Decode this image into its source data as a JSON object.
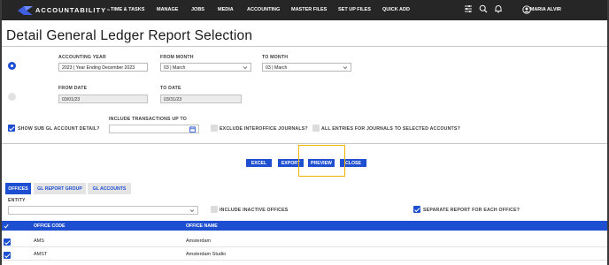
{
  "brand": {
    "name": "ACCOUNTABILITY",
    "tm": "™"
  },
  "nav": {
    "items": [
      "TIME & TASKS",
      "MANAGE",
      "JOBS",
      "MEDIA",
      "ACCOUNTING",
      "MASTER FILES",
      "SET UP FILES",
      "QUICK ADD"
    ],
    "user": "MARIA ALVIR"
  },
  "page": {
    "title": "Detail General Ledger Report Selection"
  },
  "form": {
    "accounting_year_label": "ACCOUNTING YEAR",
    "accounting_year_value": "2023 | Year Ending December 2023",
    "from_month_label": "FROM MONTH",
    "from_month_value": "03 | March",
    "to_month_label": "TO MONTH",
    "to_month_value": "03 | March",
    "from_date_label": "FROM DATE",
    "from_date_value": "03/01/23",
    "to_date_label": "TO DATE",
    "to_date_value": "03/31/23",
    "show_sub_label": "SHOW SUB GL ACCOUNT DETAIL?",
    "include_up_to_label": "INCLUDE TRANSACTIONS UP TO",
    "include_up_to_value": "",
    "exclude_interoffice_label": "EXCLUDE INTEROFFICE JOURNALS?",
    "all_entries_label": "ALL ENTRIES FOR JOURNALS TO SELECTED ACCOUNTS?"
  },
  "buttons": {
    "excel": "EXCEL",
    "export": "EXPORT",
    "preview": "PREVIEW",
    "close": "CLOSE"
  },
  "tabs": [
    "OFFICES",
    "GL REPORT GROUP",
    "GL ACCOUNTS"
  ],
  "filters": {
    "entity_label": "ENTITY",
    "entity_value": "",
    "include_inactive_label": "INCLUDE INACTIVE OFFICES",
    "separate_report_label": "SEPARATE REPORT FOR EACH OFFICE?"
  },
  "table": {
    "headers": [
      "OFFICE CODE",
      "OFFICE NAME"
    ],
    "rows": [
      {
        "code": "AMS",
        "name": "Amsterdam",
        "checked": true
      },
      {
        "code": "AMST",
        "name": "Amsterdam Studio",
        "checked": true
      }
    ]
  },
  "colors": {
    "accent": "#1f4fd1",
    "nav_bg": "#262626",
    "highlight": "#f0b400"
  }
}
